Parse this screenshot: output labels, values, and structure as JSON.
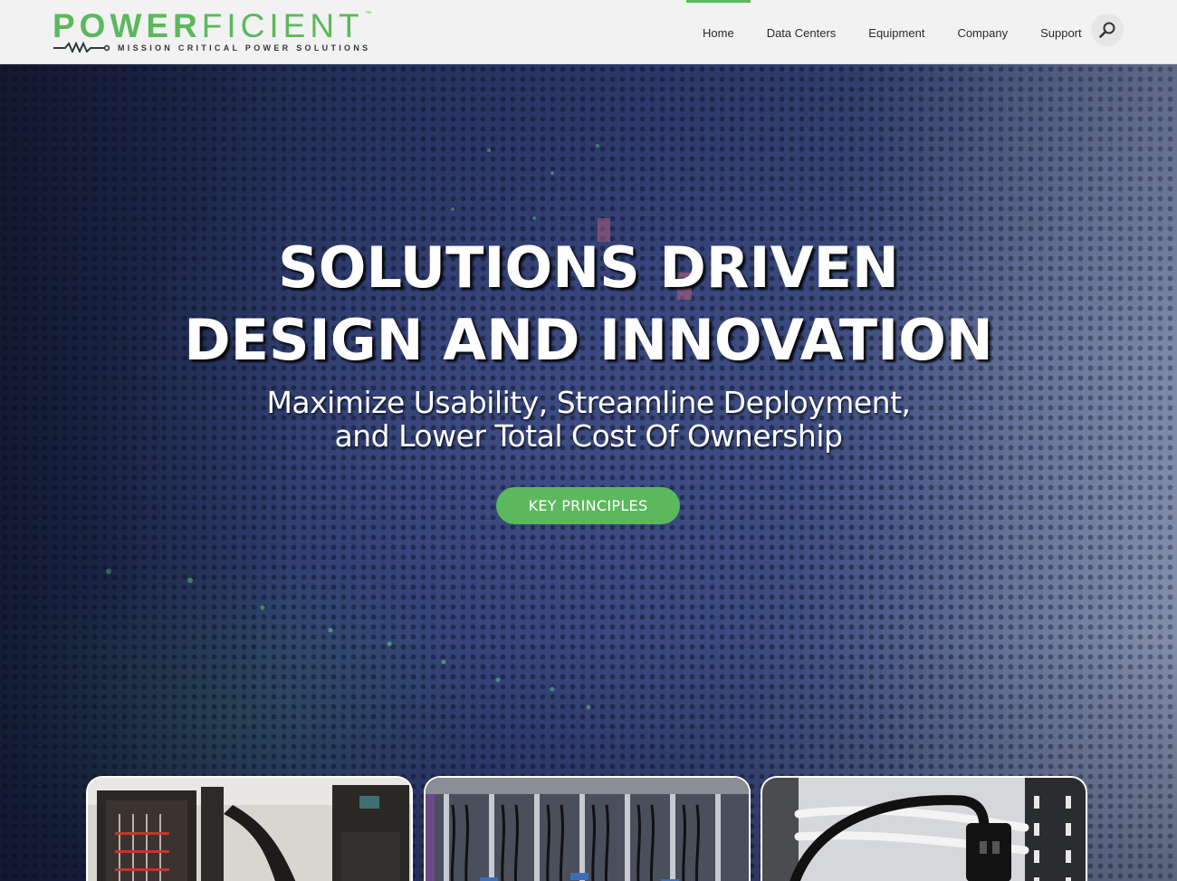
{
  "brand": {
    "name_bold": "POWER",
    "name_light": "FICIENT",
    "trademark": "™",
    "tagline": "MISSION CRITICAL POWER SOLUTIONS",
    "accent_color": "#5cb85c"
  },
  "nav": {
    "items": [
      {
        "label": "Home",
        "active": true
      },
      {
        "label": "Data Centers",
        "active": false
      },
      {
        "label": "Equipment",
        "active": false
      },
      {
        "label": "Company",
        "active": false
      },
      {
        "label": "Support",
        "active": false
      }
    ],
    "search_icon": "search-icon"
  },
  "hero": {
    "title_line1": "SOLUTIONS DRIVEN",
    "title_line2": "DESIGN AND INNOVATION",
    "subtitle_line1": "Maximize Usability, Streamline Deployment,",
    "subtitle_line2": "and Lower Total Cost Of Ownership",
    "cta_label": "KEY PRINCIPLES"
  },
  "cards": [
    {
      "image": "power-cabinet-photo"
    },
    {
      "image": "server-rack-cabling-photo"
    },
    {
      "image": "power-cord-outlet-photo"
    }
  ]
}
